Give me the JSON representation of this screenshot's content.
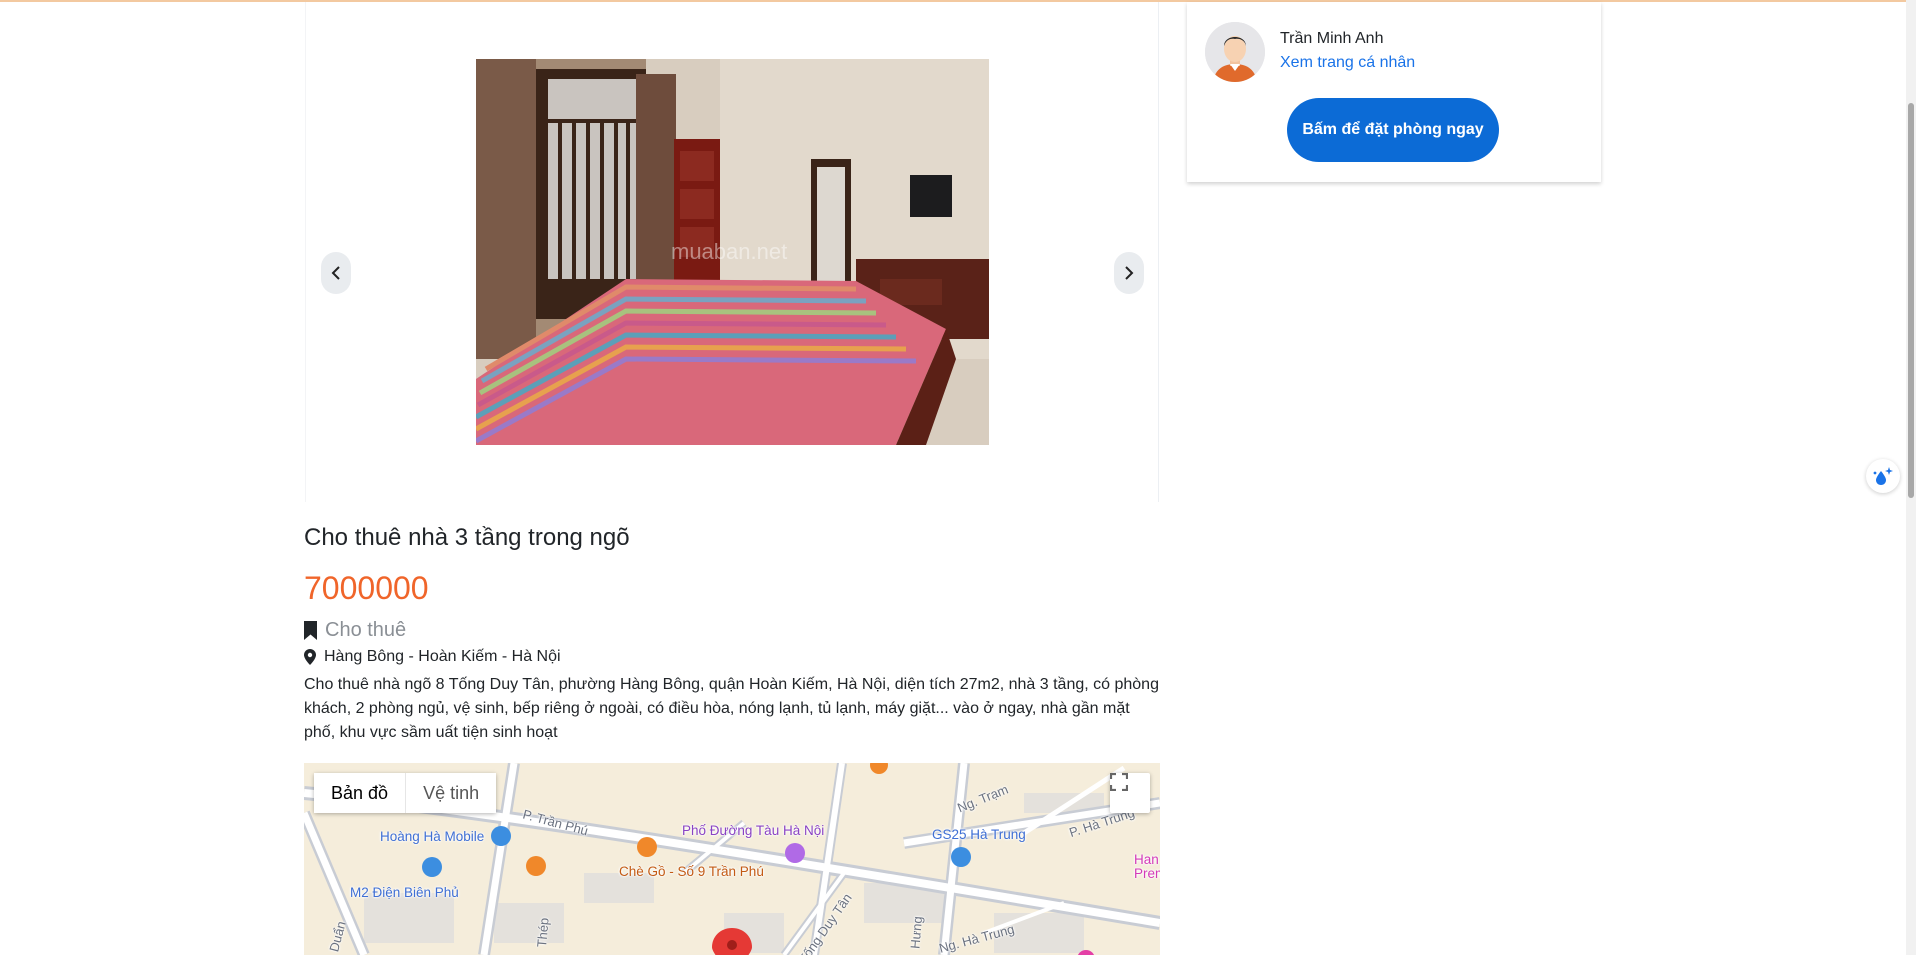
{
  "listing": {
    "title": "Cho thuê nhà 3 tầng trong ngõ",
    "price": "7000000",
    "category": "Cho thuê",
    "location": "Hàng Bông - Hoàn Kiếm - Hà Nội",
    "description": "Cho thuê nhà ngõ 8 Tống Duy Tân, phường Hàng Bông, quận Hoàn Kiếm, Hà Nội, diện tích 27m2, nhà 3 tầng, có phòng khách, 2 phòng ngủ, vệ sinh, bếp riêng ở ngoài, có điều hòa, nóng lạnh, tủ lạnh, máy giặt... vào ở ngay, nhà gần mặt phố, khu vực sầm uất tiện sinh hoạt"
  },
  "gallery": {
    "watermark": "muaban.net",
    "prev_icon": "chevron-left-icon",
    "next_icon": "chevron-right-icon"
  },
  "owner": {
    "name": "Trần Minh Anh",
    "profile_link": "Xem trang cá nhân",
    "book_button": "Bấm để đặt phòng ngay"
  },
  "map": {
    "tabs": [
      "Bản đồ",
      "Vệ tinh"
    ],
    "active_tab": "Bản đồ",
    "labels": {
      "hoang_ha_mobile": "Hoàng Hà Mobile",
      "m2_dien_bien_phu": "M2 Điện Biên Phủ",
      "che_go": "Chè Gồ - Số 9 Trần Phú",
      "pho_duong_tau": "Phố Đường Tàu Hà Nội",
      "gs25": "GS25 Hà Trung",
      "han_prem": "Han\nPrem",
      "p_tran_phu": "P. Trần Phú",
      "p_ha_trung": "P. Hà Trung",
      "ng_tram": "Ng. Trạm",
      "tong_duy_tan": "Tống Duy Tân",
      "ng_ha_trung": "Ng. Hà Trung",
      "hung": "Hưng",
      "thep": "Thép",
      "duan": "Duẩn"
    }
  },
  "colors": {
    "price": "#f0652a",
    "primary_button": "#0c6bd6",
    "link": "#1a73e8",
    "category_text": "#8a8f95"
  }
}
